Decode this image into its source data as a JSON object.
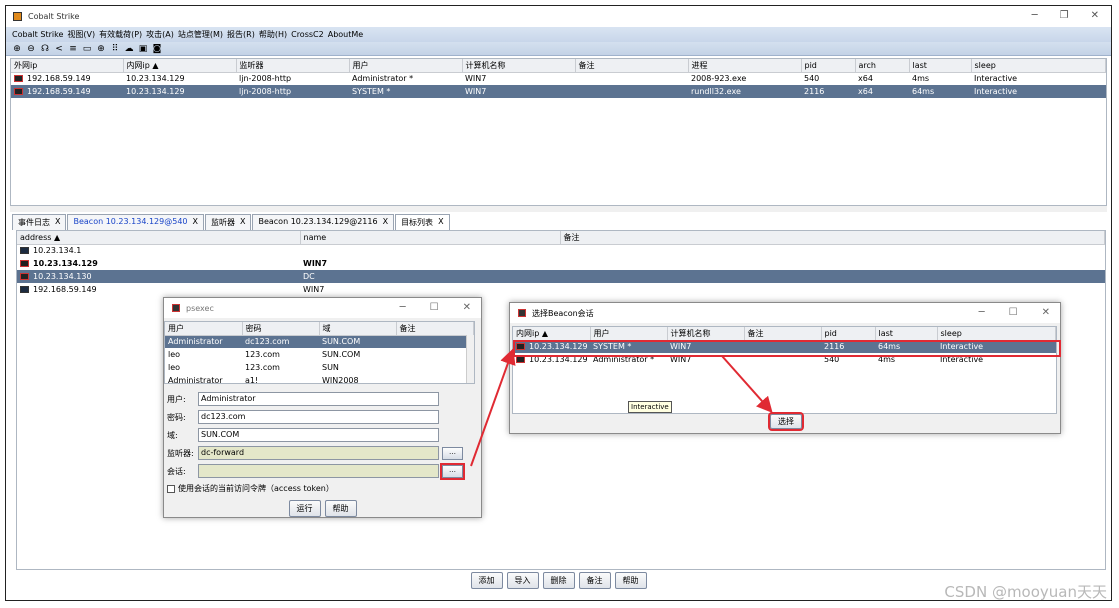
{
  "window": {
    "title": "Cobalt Strike"
  },
  "menu": [
    "Cobalt Strike",
    "视图(V)",
    "有效载荷(P)",
    "攻击(A)",
    "站点管理(M)",
    "报告(R)",
    "帮助(H)",
    "CrossC2",
    "AboutMe"
  ],
  "toolbar_icons": [
    "plus-circle-icon",
    "minus-circle-icon",
    "headphones-icon",
    "share-icon",
    "list-icon",
    "window-icon",
    "globe-icon",
    "dots-icon",
    "cloud-icon",
    "image-icon",
    "camera-icon"
  ],
  "sessions": {
    "columns": [
      "外网ip",
      "内网ip ▲",
      "监听器",
      "用户",
      "计算机名称",
      "备注",
      "进程",
      "pid",
      "arch",
      "last",
      "sleep"
    ],
    "rows": [
      [
        "192.168.59.149",
        "10.23.134.129",
        "ljn-2008-http",
        "Administrator *",
        "WIN7",
        "",
        "2008-923.exe",
        "540",
        "x64",
        "4ms",
        "Interactive"
      ],
      [
        "192.168.59.149",
        "10.23.134.129",
        "ljn-2008-http",
        "SYSTEM *",
        "WIN7",
        "",
        "rundll32.exe",
        "2116",
        "x64",
        "64ms",
        "Interactive"
      ]
    ]
  },
  "tabs": [
    {
      "label": "事件日志"
    },
    {
      "label": "Beacon 10.23.134.129@540"
    },
    {
      "label": "监听器"
    },
    {
      "label": "Beacon 10.23.134.129@2116"
    },
    {
      "label": "目标列表"
    }
  ],
  "targets": {
    "columns": [
      "address ▲",
      "name",
      "备注"
    ],
    "rows": [
      [
        "10.23.134.1",
        "",
        ""
      ],
      [
        "10.23.134.129",
        "WIN7",
        ""
      ],
      [
        "10.23.134.130",
        "DC",
        ""
      ],
      [
        "192.168.59.149",
        "WIN7",
        ""
      ]
    ]
  },
  "bottom_buttons": [
    "添加",
    "导入",
    "删除",
    "备注",
    "帮助"
  ],
  "psexec": {
    "title": "psexec",
    "columns": [
      "用户",
      "密码",
      "域",
      "备注"
    ],
    "rows": [
      [
        "Administrator",
        "dc123.com",
        "SUN.COM",
        ""
      ],
      [
        "leo",
        "123.com",
        "SUN.COM",
        ""
      ],
      [
        "leo",
        "123.com",
        "SUN",
        ""
      ],
      [
        "Administrator",
        "a1!",
        "WIN2008",
        ""
      ]
    ],
    "user_label": "用户:",
    "user_value": "Administrator",
    "pass_label": "密码:",
    "pass_value": "dc123.com",
    "domain_label": "域:",
    "domain_value": "SUN.COM",
    "listener_label": "监听器:",
    "listener_value": "dc-forward",
    "session_label": "会话:",
    "session_value": "",
    "token_label": "使用会话的当前访问令牌（access token）",
    "run_label": "运行",
    "help_label": "帮助"
  },
  "beacon_dialog": {
    "title": "选择Beacon会话",
    "columns": [
      "内网ip ▲",
      "用户",
      "计算机名称",
      "备注",
      "pid",
      "last",
      "sleep"
    ],
    "rows": [
      [
        "10.23.134.129",
        "SYSTEM *",
        "WIN7",
        "",
        "2116",
        "64ms",
        "Interactive"
      ],
      [
        "10.23.134.129",
        "Administrator *",
        "WIN7",
        "",
        "540",
        "4ms",
        "Interactive"
      ]
    ],
    "tooltip": "Interactive",
    "select_label": "选择"
  },
  "watermark": "CSDN @mooyuan天天",
  "colors": {
    "selection": "#5c7391",
    "highlight": "#e02a33",
    "menubar": "#d9e4f2"
  }
}
